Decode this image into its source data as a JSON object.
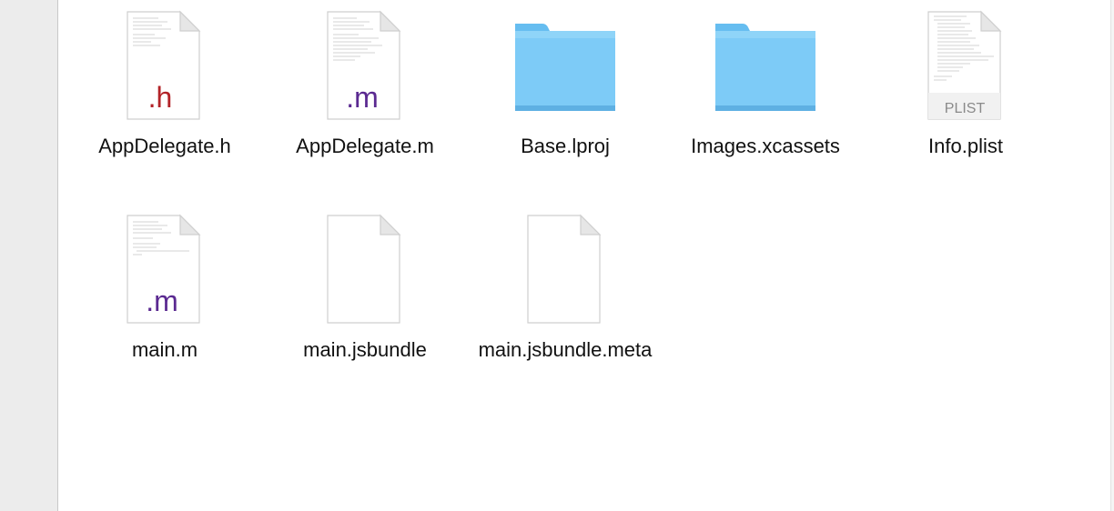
{
  "files": [
    {
      "name": "AppDelegate.h",
      "kind": "header-file-icon",
      "badge": ".h",
      "badge_color": "#b32328"
    },
    {
      "name": "AppDelegate.m",
      "kind": "objc-file-icon",
      "badge": ".m",
      "badge_color": "#5b2a91"
    },
    {
      "name": "Base.lproj",
      "kind": "folder-icon",
      "folder_color": "#6cc4f4"
    },
    {
      "name": "Images.xcassets",
      "kind": "folder-icon",
      "folder_color": "#6cc4f4"
    },
    {
      "name": "Info.plist",
      "kind": "plist-file-icon",
      "badge": "PLIST",
      "badge_color": "#8a8a8a"
    },
    {
      "name": "main.m",
      "kind": "objc-file-icon",
      "badge": ".m",
      "badge_color": "#5b2a91"
    },
    {
      "name": "main.jsbundle",
      "kind": "blank-document-icon"
    },
    {
      "name": "main.jsbundle.meta",
      "kind": "blank-document-icon"
    }
  ]
}
